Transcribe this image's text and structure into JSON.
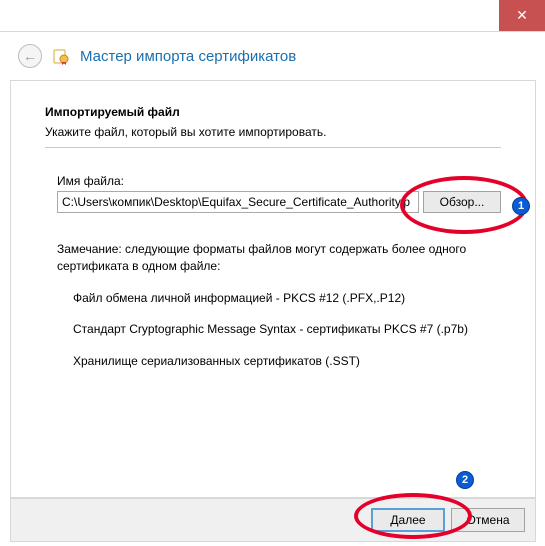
{
  "window": {
    "close_glyph": "✕"
  },
  "header": {
    "back_glyph": "←",
    "title": "Мастер импорта сертификатов"
  },
  "main": {
    "section_title": "Импортируемый файл",
    "section_sub": "Укажите файл, который вы хотите импортировать.",
    "file_label": "Имя файла:",
    "file_value": "C:\\Users\\компик\\Desktop\\Equifax_Secure_Certificate_Authority.p",
    "browse_label": "Обзор...",
    "note_lead": "Замечание: следующие форматы файлов могут содержать более одного сертификата в одном файле:",
    "note_items": [
      "Файл обмена личной информацией - PKCS #12 (.PFX,.P12)",
      "Стандарт Cryptographic Message Syntax - сертификаты PKCS #7 (.p7b)",
      "Хранилище сериализованных сертификатов (.SST)"
    ]
  },
  "footer": {
    "next_label": "Далее",
    "cancel_label": "Отмена"
  },
  "annotations": {
    "badge1": "1",
    "badge2": "2"
  }
}
